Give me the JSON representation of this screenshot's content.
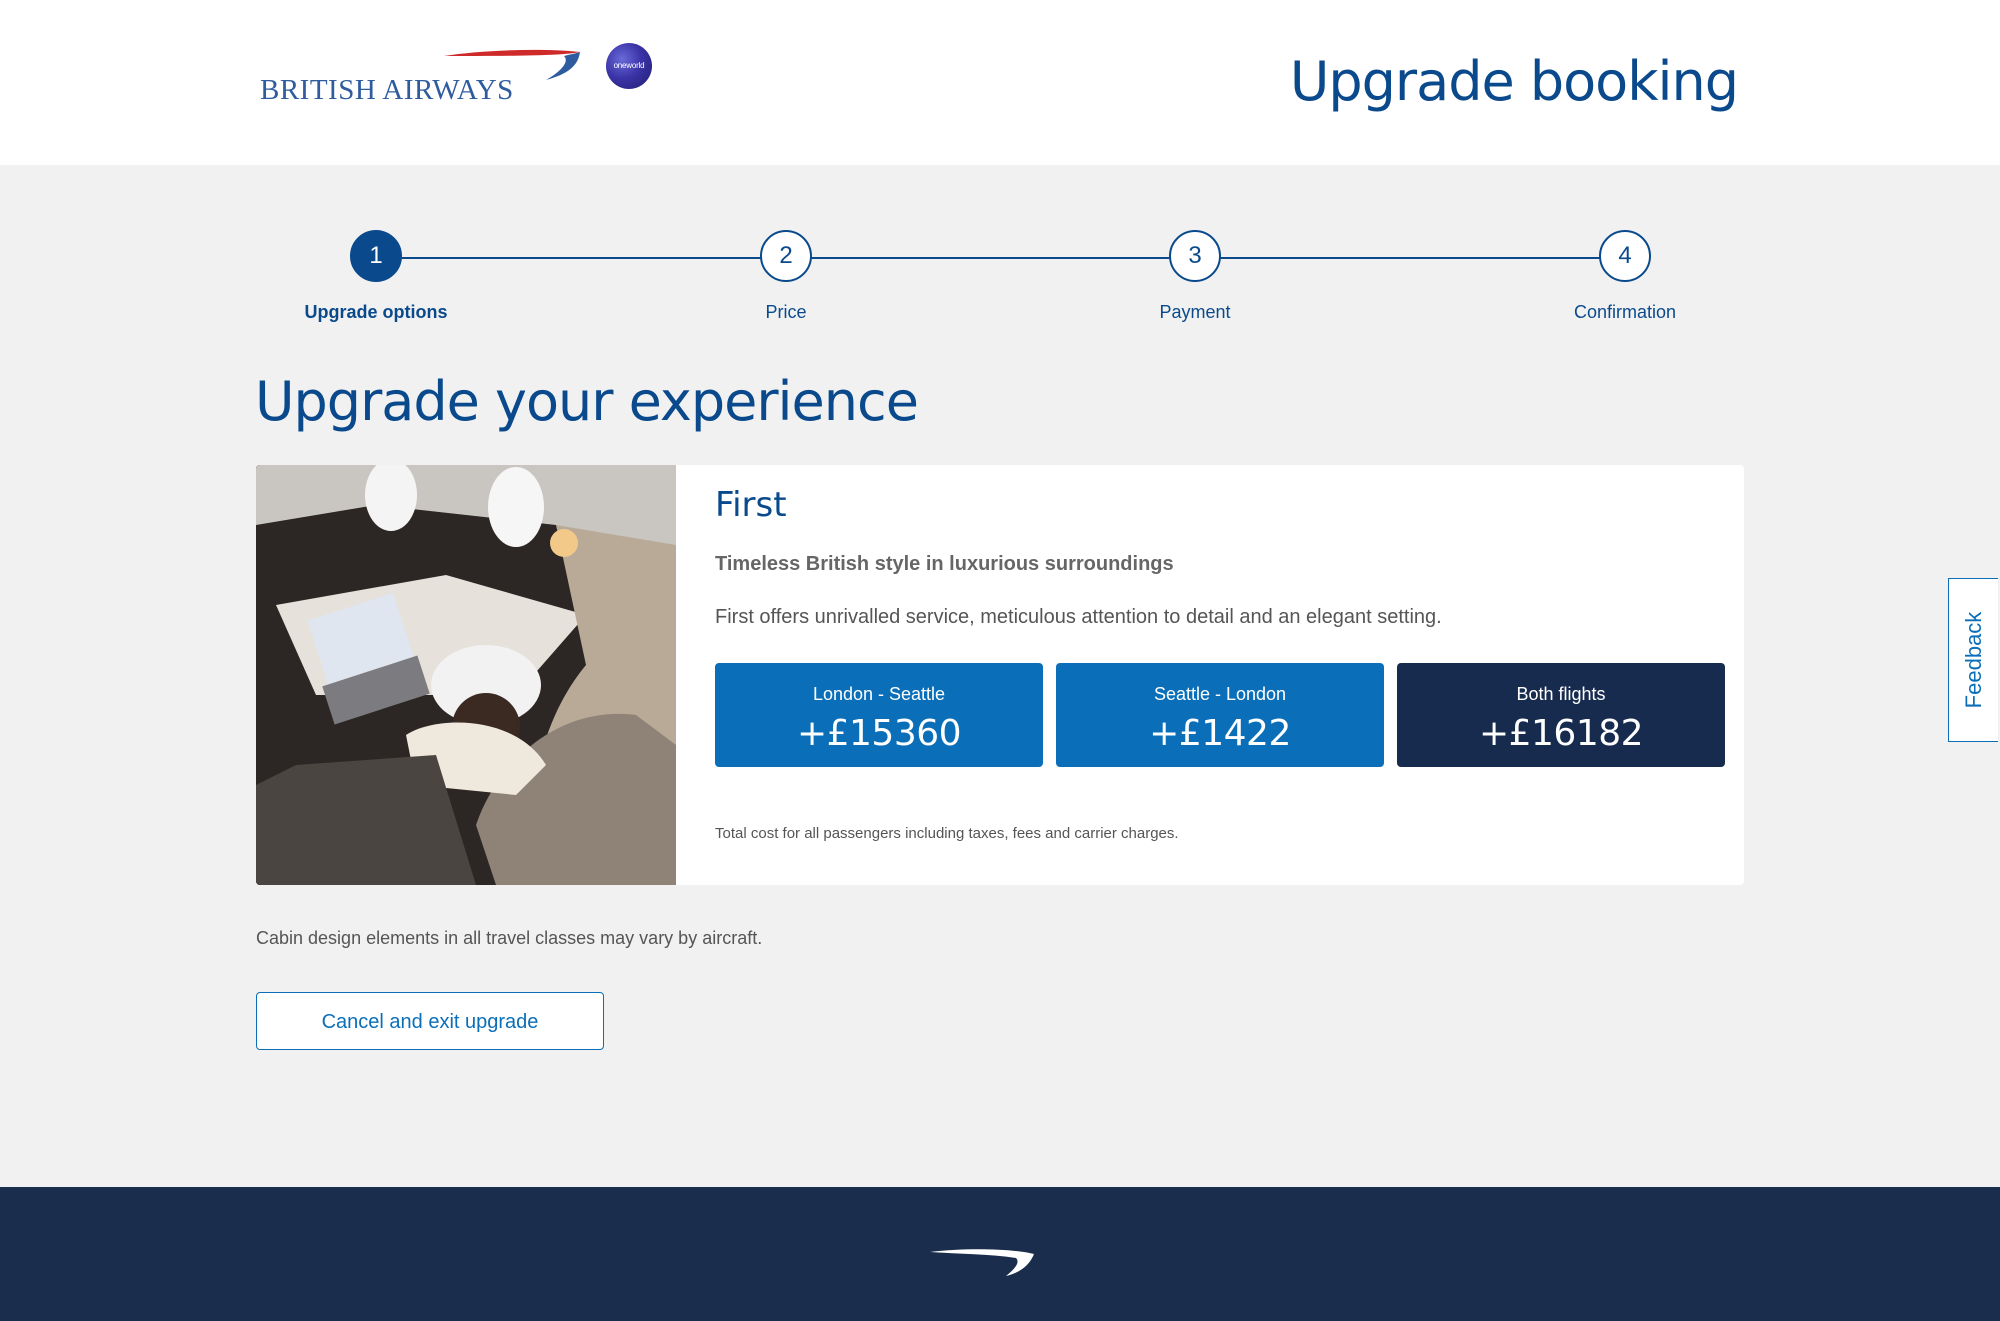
{
  "header": {
    "brand": "BRITISH AIRWAYS",
    "alliance_badge": "oneworld",
    "page_heading": "Upgrade booking"
  },
  "steps": [
    {
      "number": "1",
      "label": "Upgrade options",
      "state": "active"
    },
    {
      "number": "2",
      "label": "Price",
      "state": "upcoming"
    },
    {
      "number": "3",
      "label": "Payment",
      "state": "upcoming"
    },
    {
      "number": "4",
      "label": "Confirmation",
      "state": "upcoming"
    }
  ],
  "main": {
    "title": "Upgrade your experience",
    "cabin_note": "Cabin design elements in all travel classes may vary by aircraft.",
    "cancel_label": "Cancel and exit upgrade"
  },
  "offer": {
    "class_name": "First",
    "tagline": "Timeless British style in luxurious surroundings",
    "description": "First offers unrivalled service, meticulous attention to detail and an elegant setting.",
    "prices": [
      {
        "route": "London - Seattle",
        "amount": "+£15360"
      },
      {
        "route": "Seattle - London",
        "amount": "+£1422"
      },
      {
        "route": "Both flights",
        "amount": "+£16182"
      }
    ],
    "cost_note": "Total cost for all passengers including taxes, fees and carrier charges."
  },
  "feedback_label": "Feedback",
  "colors": {
    "brand_blue": "#0a4a8c",
    "button_blue": "#0a6fb8",
    "navy": "#172b4f",
    "footer": "#1b2d4d",
    "background": "#f1f1f1"
  },
  "icons": {
    "brand_logo": "speedmarque-ribbon",
    "alliance": "oneworld-globe",
    "footer_logo": "speedmarque-ribbon"
  }
}
